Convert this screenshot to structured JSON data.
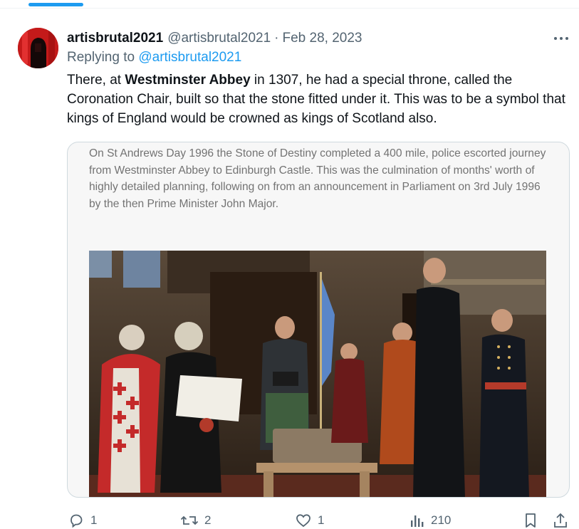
{
  "tweet": {
    "author_name": "artisbrutal2021",
    "handle": "@artisbrutal2021",
    "separator": "·",
    "date": "Feb 28, 2023",
    "replying_prefix": "Replying to",
    "replying_to": "@artisbrutal2021",
    "text_before": "There, at ",
    "text_bold": "Westminster Abbey",
    "text_after": " in 1307, he had a special throne, called the Coronation Chair, built so that the stone fitted under it. This was to be a symbol that kings of England would be crowned as kings of Scotland also.",
    "media_text": "On St Andrews Day 1996 the Stone of Destiny completed a 400 mile, police escorted journey from Westminster Abbey to Edinburgh Castle. This was the culmination of months' worth of highly detailed planning, following on from an announcement in Parliament on 3rd July 1996 by the then Prime Minister John Major."
  },
  "actions": {
    "replies": "1",
    "retweets": "2",
    "likes": "1",
    "views": "210"
  },
  "icons": {
    "more": "more-horizontal-icon",
    "reply": "reply-icon",
    "retweet": "retweet-icon",
    "like": "heart-icon",
    "views": "views-icon",
    "bookmark": "bookmark-icon",
    "share": "share-icon"
  },
  "colors": {
    "accent": "#1d9bf0",
    "muted": "#536471",
    "text": "#0f1419"
  }
}
